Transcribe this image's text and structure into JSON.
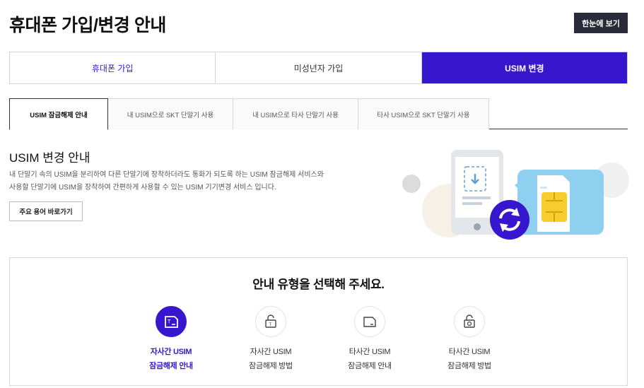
{
  "header": {
    "title": "휴대폰 가입/변경 안내",
    "summary_button": "한눈에 보기"
  },
  "main_tabs": [
    {
      "label": "휴대폰 가입"
    },
    {
      "label": "미성년자 가입"
    },
    {
      "label": "USIM 변경"
    }
  ],
  "sub_tabs": [
    {
      "label": "USIM 잠금해제 안내"
    },
    {
      "label": "내 USIM으로 SKT 단말기 사용"
    },
    {
      "label": "내 USIM으로 타사 단말기 사용"
    },
    {
      "label": "타사 USIM으로 SKT 단말기 사용"
    }
  ],
  "section": {
    "title": "USIM 변경 안내",
    "desc_line1": "내 단말기 속의 USIM을 분리하여 다른 단말기에 장착하더라도 통화가 되도록 하는 USIM 잠금해제 서비스와",
    "desc_line2": "사용할 단말기에 USIM을 장착하여 간편하게 사용할 수 있는 USIM 기기변경 서비스 입니다.",
    "terms_button": "주요 용어 바로가기"
  },
  "selector": {
    "title": "안내 유형을 선택해 주세요.",
    "items": [
      {
        "line1": "자사간 USIM",
        "line2": "잠금해제 안내",
        "icon": "sim-card-icon"
      },
      {
        "line1": "자사간 USIM",
        "line2": "잠금해제 방법",
        "icon": "unlock-icon"
      },
      {
        "line1": "타사간 USIM",
        "line2": "잠금해제 안내",
        "icon": "sim-card-icon"
      },
      {
        "line1": "타사간 USIM",
        "line2": "잠금해제 방법",
        "icon": "unlock-icon"
      }
    ]
  },
  "colors": {
    "accent": "#3617ce",
    "dark_button": "#2a2a3a",
    "illustration_blue": "#8fd0f0"
  }
}
